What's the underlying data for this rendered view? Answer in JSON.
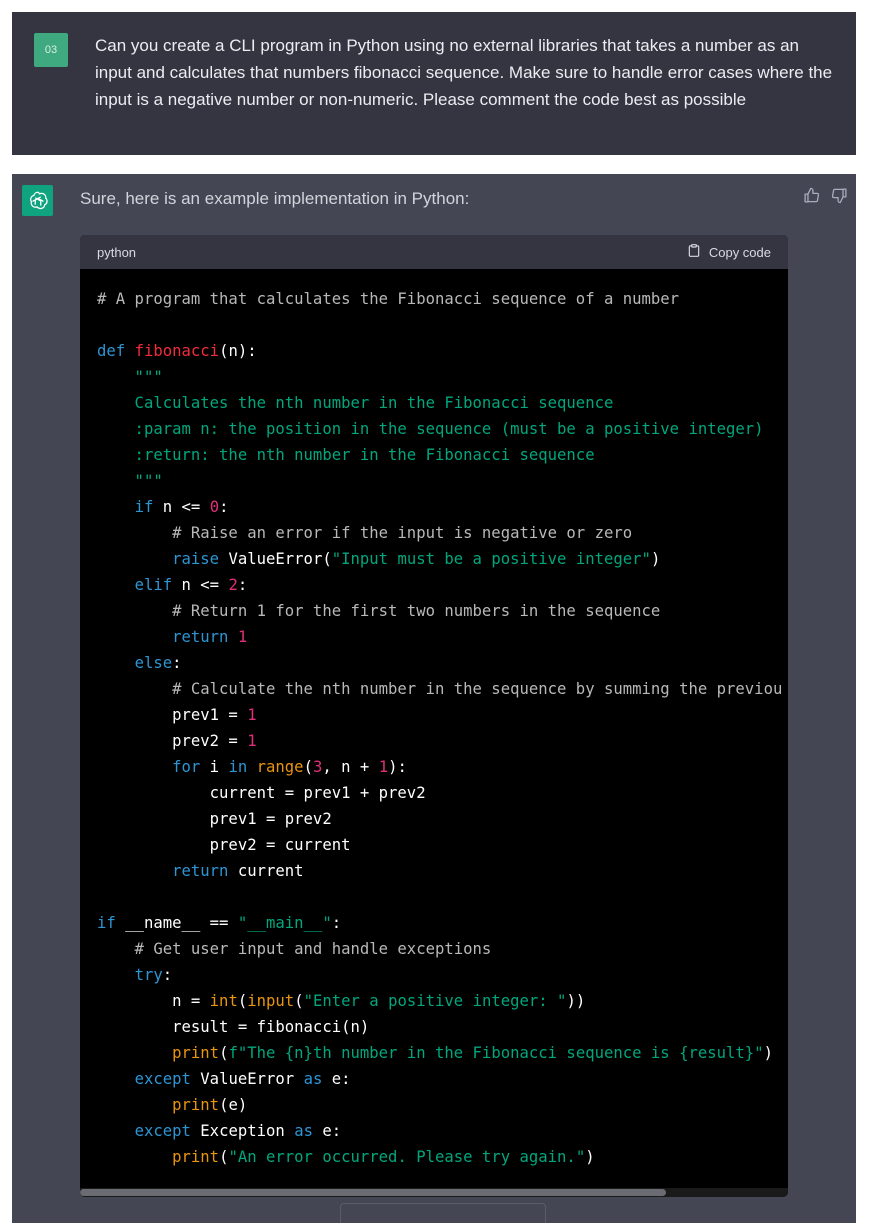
{
  "user_message": {
    "avatar_label": "03",
    "text": "Can you create a CLI program in Python using no external libraries that takes a number as an input and calculates that numbers fibonacci sequence. Make sure to handle error cases where the input is a negative number or non-numeric. Please comment the code best as possible"
  },
  "assistant_message": {
    "avatar_icon": "openai-logo-icon",
    "intro": "Sure, here is an example implementation in Python:",
    "feedback": {
      "thumbs_up_icon": "thumbs-up-icon",
      "thumbs_down_icon": "thumbs-down-icon"
    },
    "code_block": {
      "language": "python",
      "copy_label": "Copy code",
      "lines": [
        [
          {
            "t": "# A program that calculates the Fibonacci sequence of a number",
            "c": "comment"
          }
        ],
        [],
        [
          {
            "t": "def ",
            "c": "kw"
          },
          {
            "t": "fibonacci",
            "c": "fn"
          },
          {
            "t": "(n):",
            "c": "plain"
          }
        ],
        [
          {
            "t": "    \"\"\"",
            "c": "str"
          }
        ],
        [
          {
            "t": "    Calculates the nth number in the Fibonacci sequence",
            "c": "str"
          }
        ],
        [
          {
            "t": "    :param n: the position in the sequence (must be a positive integer)",
            "c": "str"
          }
        ],
        [
          {
            "t": "    :return: the nth number in the Fibonacci sequence",
            "c": "str"
          }
        ],
        [
          {
            "t": "    \"\"\"",
            "c": "str"
          }
        ],
        [
          {
            "t": "    ",
            "c": "plain"
          },
          {
            "t": "if",
            "c": "kw"
          },
          {
            "t": " n <= ",
            "c": "plain"
          },
          {
            "t": "0",
            "c": "num"
          },
          {
            "t": ":",
            "c": "plain"
          }
        ],
        [
          {
            "t": "        # Raise an error if the input is negative or zero",
            "c": "comment"
          }
        ],
        [
          {
            "t": "        ",
            "c": "plain"
          },
          {
            "t": "raise",
            "c": "kw"
          },
          {
            "t": " ValueError(",
            "c": "plain"
          },
          {
            "t": "\"Input must be a positive integer\"",
            "c": "str"
          },
          {
            "t": ")",
            "c": "plain"
          }
        ],
        [
          {
            "t": "    ",
            "c": "plain"
          },
          {
            "t": "elif",
            "c": "kw"
          },
          {
            "t": " n <= ",
            "c": "plain"
          },
          {
            "t": "2",
            "c": "num"
          },
          {
            "t": ":",
            "c": "plain"
          }
        ],
        [
          {
            "t": "        # Return 1 for the first two numbers in the sequence",
            "c": "comment"
          }
        ],
        [
          {
            "t": "        ",
            "c": "plain"
          },
          {
            "t": "return",
            "c": "kw"
          },
          {
            "t": " ",
            "c": "plain"
          },
          {
            "t": "1",
            "c": "num"
          }
        ],
        [
          {
            "t": "    ",
            "c": "plain"
          },
          {
            "t": "else",
            "c": "kw"
          },
          {
            "t": ":",
            "c": "plain"
          }
        ],
        [
          {
            "t": "        # Calculate the nth number in the sequence by summing the previou",
            "c": "comment"
          }
        ],
        [
          {
            "t": "        prev1 = ",
            "c": "plain"
          },
          {
            "t": "1",
            "c": "num"
          }
        ],
        [
          {
            "t": "        prev2 = ",
            "c": "plain"
          },
          {
            "t": "1",
            "c": "num"
          }
        ],
        [
          {
            "t": "        ",
            "c": "plain"
          },
          {
            "t": "for",
            "c": "kw"
          },
          {
            "t": " i ",
            "c": "plain"
          },
          {
            "t": "in",
            "c": "kw"
          },
          {
            "t": " ",
            "c": "plain"
          },
          {
            "t": "range",
            "c": "builtin"
          },
          {
            "t": "(",
            "c": "plain"
          },
          {
            "t": "3",
            "c": "num"
          },
          {
            "t": ", n + ",
            "c": "plain"
          },
          {
            "t": "1",
            "c": "num"
          },
          {
            "t": "):",
            "c": "plain"
          }
        ],
        [
          {
            "t": "            current = prev1 + prev2",
            "c": "plain"
          }
        ],
        [
          {
            "t": "            prev1 = prev2",
            "c": "plain"
          }
        ],
        [
          {
            "t": "            prev2 = current",
            "c": "plain"
          }
        ],
        [
          {
            "t": "        ",
            "c": "plain"
          },
          {
            "t": "return",
            "c": "kw"
          },
          {
            "t": " current",
            "c": "plain"
          }
        ],
        [],
        [
          {
            "t": "if",
            "c": "kw"
          },
          {
            "t": " __name__ == ",
            "c": "plain"
          },
          {
            "t": "\"__main__\"",
            "c": "str"
          },
          {
            "t": ":",
            "c": "plain"
          }
        ],
        [
          {
            "t": "    # Get user input and handle exceptions",
            "c": "comment"
          }
        ],
        [
          {
            "t": "    ",
            "c": "plain"
          },
          {
            "t": "try",
            "c": "kw"
          },
          {
            "t": ":",
            "c": "plain"
          }
        ],
        [
          {
            "t": "        n = ",
            "c": "plain"
          },
          {
            "t": "int",
            "c": "builtin"
          },
          {
            "t": "(",
            "c": "plain"
          },
          {
            "t": "input",
            "c": "builtin"
          },
          {
            "t": "(",
            "c": "plain"
          },
          {
            "t": "\"Enter a positive integer: \"",
            "c": "str"
          },
          {
            "t": "))",
            "c": "plain"
          }
        ],
        [
          {
            "t": "        result = fibonacci(n)",
            "c": "plain"
          }
        ],
        [
          {
            "t": "        ",
            "c": "plain"
          },
          {
            "t": "print",
            "c": "builtin"
          },
          {
            "t": "(",
            "c": "plain"
          },
          {
            "t": "f\"The {n}th number in the Fibonacci sequence is {result}\"",
            "c": "str"
          },
          {
            "t": ")",
            "c": "plain"
          }
        ],
        [
          {
            "t": "    ",
            "c": "plain"
          },
          {
            "t": "except",
            "c": "kw"
          },
          {
            "t": " ValueError ",
            "c": "plain"
          },
          {
            "t": "as",
            "c": "kw"
          },
          {
            "t": " e:",
            "c": "plain"
          }
        ],
        [
          {
            "t": "        ",
            "c": "plain"
          },
          {
            "t": "print",
            "c": "builtin"
          },
          {
            "t": "(e)",
            "c": "plain"
          }
        ],
        [
          {
            "t": "    ",
            "c": "plain"
          },
          {
            "t": "except",
            "c": "kw"
          },
          {
            "t": " Exception ",
            "c": "plain"
          },
          {
            "t": "as",
            "c": "kw"
          },
          {
            "t": " e:",
            "c": "plain"
          }
        ],
        [
          {
            "t": "        ",
            "c": "plain"
          },
          {
            "t": "print",
            "c": "builtin"
          },
          {
            "t": "(",
            "c": "plain"
          },
          {
            "t": "\"An error occurred. Please try again.\"",
            "c": "str"
          },
          {
            "t": ")",
            "c": "plain"
          }
        ]
      ]
    }
  },
  "colors": {
    "user_bg": "#343541",
    "assistant_bg": "#444654",
    "code_bg": "#000000",
    "code_header_bg": "#343541",
    "user_avatar": "#3fa980",
    "gpt_avatar": "#10a37f",
    "keyword": "#2e95d3",
    "function": "#f22c3d",
    "string": "#00a67d",
    "number": "#df3079",
    "builtin": "#e9950c",
    "comment": "#b8b8b8"
  }
}
